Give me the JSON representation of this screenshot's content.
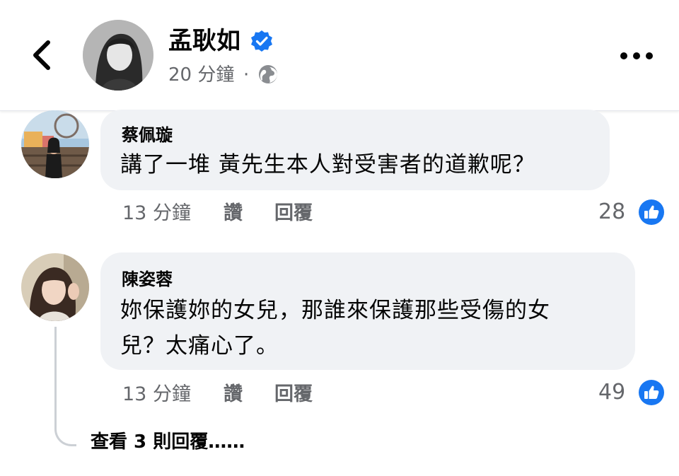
{
  "header": {
    "page_name": "孟耿如",
    "time": "20 分鐘",
    "dot": "·",
    "back_icon": "chevron-left-icon",
    "verified_icon": "verified-badge-icon",
    "privacy_icon": "globe-icon",
    "more_icon": "more-horizontal-icon",
    "verified_color": "#1877f2"
  },
  "comments": [
    {
      "author": "蔡佩璇",
      "lines": [
        "講了一堆 黃先生本人對受害者的道歉呢？"
      ],
      "time": "13 分鐘",
      "like_label": "讚",
      "reply_label": "回覆",
      "likes": "28"
    },
    {
      "author": "陳姿蓉",
      "lines": [
        "妳保護妳的女兒，那誰來保護那些受傷的女",
        "兒？太痛心了。"
      ],
      "time": "13 分鐘",
      "like_label": "讚",
      "reply_label": "回覆",
      "likes": "49"
    }
  ],
  "view_replies": "查看 3 則回覆……",
  "like_icon": "thumbs-up-icon",
  "colors": {
    "bubble": "#f0f2f5",
    "meta_text": "#65676b",
    "like_blue": "#1877f2"
  }
}
